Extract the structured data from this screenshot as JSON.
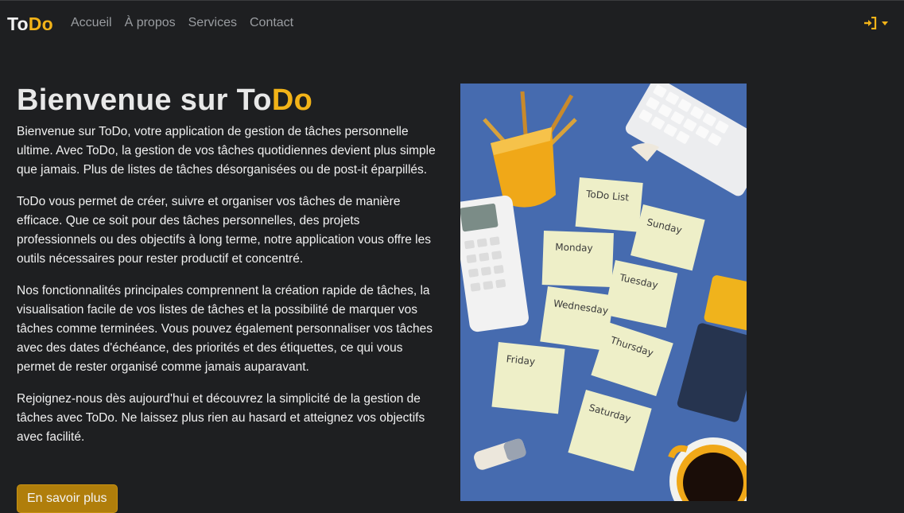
{
  "navbar": {
    "brand_part1": "To",
    "brand_part2": "Do",
    "links": [
      "Accueil",
      "À propos",
      "Services",
      "Contact"
    ],
    "login_icon": "sign-in-icon"
  },
  "main": {
    "title_part1": "Bienvenue sur To",
    "title_part2": "Do",
    "paragraphs": [
      "Bienvenue sur ToDo, votre application de gestion de tâches personnelle ultime. Avec ToDo, la gestion de vos tâches quotidiennes devient plus simple que jamais. Plus de listes de tâches désorganisées ou de post-it éparpillés.",
      "ToDo vous permet de créer, suivre et organiser vos tâches de manière efficace. Que ce soit pour des tâches personnelles, des projets professionnels ou des objectifs à long terme, notre application vous offre les outils nécessaires pour rester productif et concentré.",
      "Nos fonctionnalités principales comprennent la création rapide de tâches, la visualisation facile de vos listes de tâches et la possibilité de marquer vos tâches comme terminées. Vous pouvez également personnaliser vos tâches avec des dates d'échéance, des priorités et des étiquettes, ce qui vous permet de rester organisé comme jamais auparavant.",
      "Rejoignez-nous dès aujourd'hui et découvrez la simplicité de la gestion de tâches avec ToDo. Ne laissez plus rien au hasard et atteignez vos objectifs avec facilité."
    ],
    "cta_label": "En savoir plus"
  },
  "hero_image": {
    "notes": [
      "ToDo List",
      "Sunday",
      "Monday",
      "Tuesday",
      "Wednesday",
      "Thursday",
      "Friday",
      "Saturday"
    ]
  },
  "colors": {
    "accent": "#f2b318",
    "background": "#1e1f21",
    "nav_link": "#9a9da1",
    "button": "#b07e0b"
  }
}
